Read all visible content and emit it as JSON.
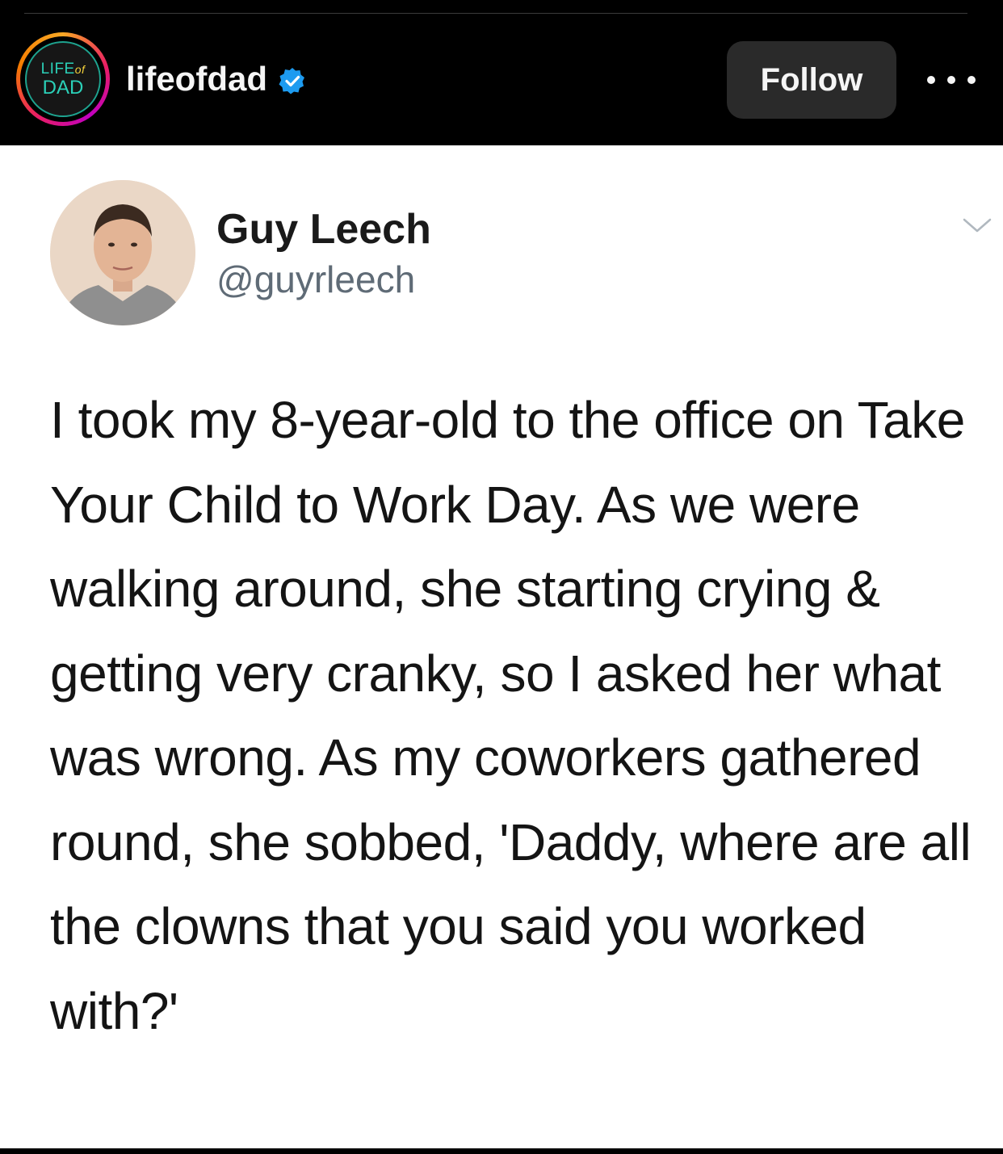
{
  "header": {
    "logo": {
      "line1": "LIFE",
      "of": "of",
      "line2": "DAD"
    },
    "username": "lifeofdad",
    "follow_label": "Follow",
    "more_icon": "more-horizontal-icon",
    "verified_icon": "verified-badge-icon",
    "colors": {
      "background": "#000000",
      "verified": "#1d9bf0",
      "follow_bg": "#2a2a2a"
    }
  },
  "tweet": {
    "author_name": "Guy Leech",
    "author_handle": "@guyrleech",
    "menu_icon": "chevron-down-icon",
    "text": "I took my 8-year-old to the office on Take Your Child to Work Day. As we were walking around, she starting crying & getting very cranky, so I asked her what was wrong. As my coworkers gathered round, she sobbed, 'Daddy, where are all the clowns that you said you worked with?'"
  }
}
